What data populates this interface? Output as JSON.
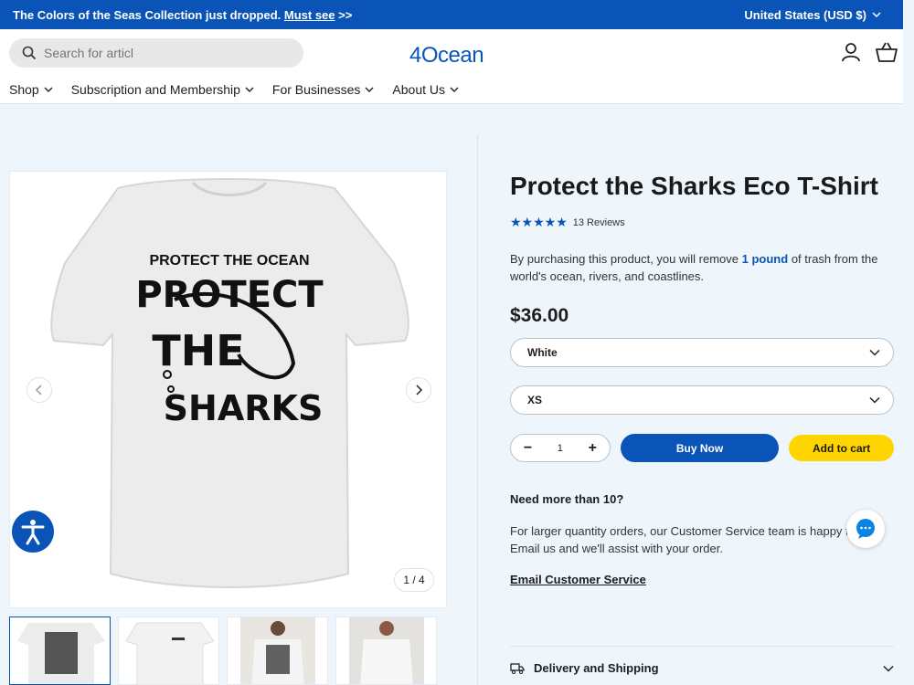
{
  "announcement": {
    "text": "The Colors of the Seas Collection just dropped.",
    "link": "Must see",
    "suffix": ">>",
    "currency": "United States (USD $)"
  },
  "header": {
    "search_placeholder": "Search for articl",
    "logo": "4Ocean"
  },
  "nav": [
    {
      "label": "Shop"
    },
    {
      "label": "Subscription and Membership"
    },
    {
      "label": "For Businesses"
    },
    {
      "label": "About Us"
    }
  ],
  "gallery": {
    "shirt_top_text": "PROTECT THE OCEAN",
    "shirt_words": [
      "PROTECT",
      "THE",
      "SHARKS"
    ],
    "counter": "1 / 4"
  },
  "product": {
    "title": "Protect the Sharks Eco T-Shirt",
    "rating": 5,
    "reviews": "13 Reviews",
    "desc_pre": "By purchasing this product, you will remove",
    "desc_highlight": "1 pound",
    "desc_post": "of trash from the world's ocean, rivers, and coastlines.",
    "price": "$36.00",
    "color_value": "White",
    "size_value": "XS",
    "quantity": "1",
    "buy_now": "Buy Now",
    "add_to_cart": "Add to cart",
    "more_heading": "Need more than 10?",
    "more_text": "For larger quantity orders, our Customer Service team is happy to help. Email us and we'll assist with your order.",
    "email_link": "Email Customer Service",
    "accordion_delivery": "Delivery and Shipping"
  },
  "colors": {
    "brand_blue": "#0a54b8",
    "cart_yellow": "#ffd500"
  }
}
